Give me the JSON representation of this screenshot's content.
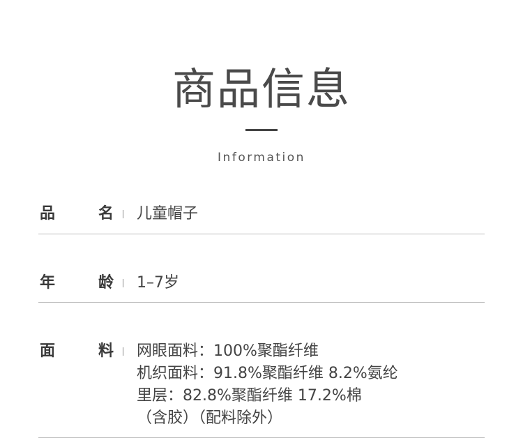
{
  "header": {
    "title": "商品信息",
    "subtitle": "Information"
  },
  "rows": [
    {
      "label_chars": [
        "品",
        "名"
      ],
      "value": "儿童帽子"
    },
    {
      "label_chars": [
        "年",
        "龄"
      ],
      "value": "1–7岁"
    },
    {
      "label_chars": [
        "面",
        "料"
      ],
      "value_lines": [
        "网眼面料：100%聚酯纤维",
        "机织面料：91.8%聚酯纤维 8.2%氨纶",
        "里层：82.8%聚酯纤维 17.2%棉",
        "（含胶）（配料除外）"
      ]
    }
  ],
  "colors": {
    "text": "#3a3a3a",
    "divider": "#bcbcbc",
    "accent_bar": "#444444"
  }
}
